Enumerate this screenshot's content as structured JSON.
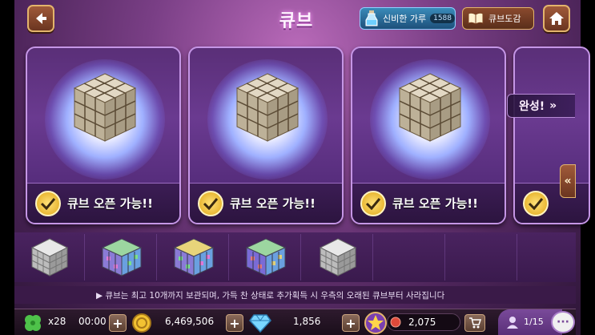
{
  "header": {
    "title": "큐브",
    "powder_label": "신비한 가루",
    "powder_count": "1588",
    "codex_label": "큐브도감"
  },
  "cards": [
    {
      "status": "큐브 오픈 가능!!"
    },
    {
      "status": "큐브 오픈 가능!!"
    },
    {
      "status": "큐브 오픈 가능!!"
    }
  ],
  "complete_label": "완성!",
  "slots": [
    "silver-cube",
    "jewel-cube",
    "jewel-cube",
    "jewel-cube",
    "silver-cube",
    "empty",
    "empty",
    "empty"
  ],
  "notice": "▶ 큐브는 최고 10개까지 보관되며, 가득 찬 상태로 추가획득 시 우측의 오래된 큐브부터 사라집니다",
  "bottom": {
    "clover_count": "x28",
    "clover_timer": "00:00",
    "gold": "6,469,506",
    "gems": "1,856",
    "star_points": "2,075",
    "friends": "1/15"
  },
  "colors": {
    "accent": "#c596e6",
    "gold": "#e0a617",
    "background": "#4a2357"
  }
}
